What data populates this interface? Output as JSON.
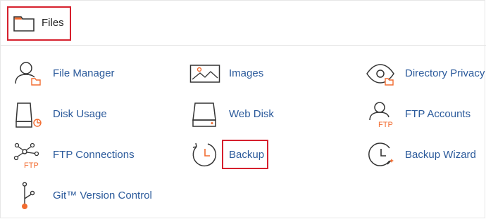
{
  "header": {
    "title": "Files",
    "icon": "folder-icon"
  },
  "items": [
    {
      "label": "File Manager",
      "icon": "file-manager-icon"
    },
    {
      "label": "Images",
      "icon": "images-icon"
    },
    {
      "label": "Directory Privacy",
      "icon": "directory-privacy-icon"
    },
    {
      "label": "Disk Usage",
      "icon": "disk-usage-icon"
    },
    {
      "label": "Web Disk",
      "icon": "web-disk-icon"
    },
    {
      "label": "FTP Accounts",
      "icon": "ftp-accounts-icon"
    },
    {
      "label": "FTP Connections",
      "icon": "ftp-connections-icon"
    },
    {
      "label": "Backup",
      "icon": "backup-icon"
    },
    {
      "label": "Backup Wizard",
      "icon": "backup-wizard-icon"
    },
    {
      "label": "Git™ Version Control",
      "icon": "git-icon"
    }
  ],
  "icon_text": {
    "ftp": "FTP"
  },
  "colors": {
    "accent": "#f26c30",
    "link": "#2b5a9b",
    "highlight": "#d6202d",
    "stroke": "#333333"
  }
}
